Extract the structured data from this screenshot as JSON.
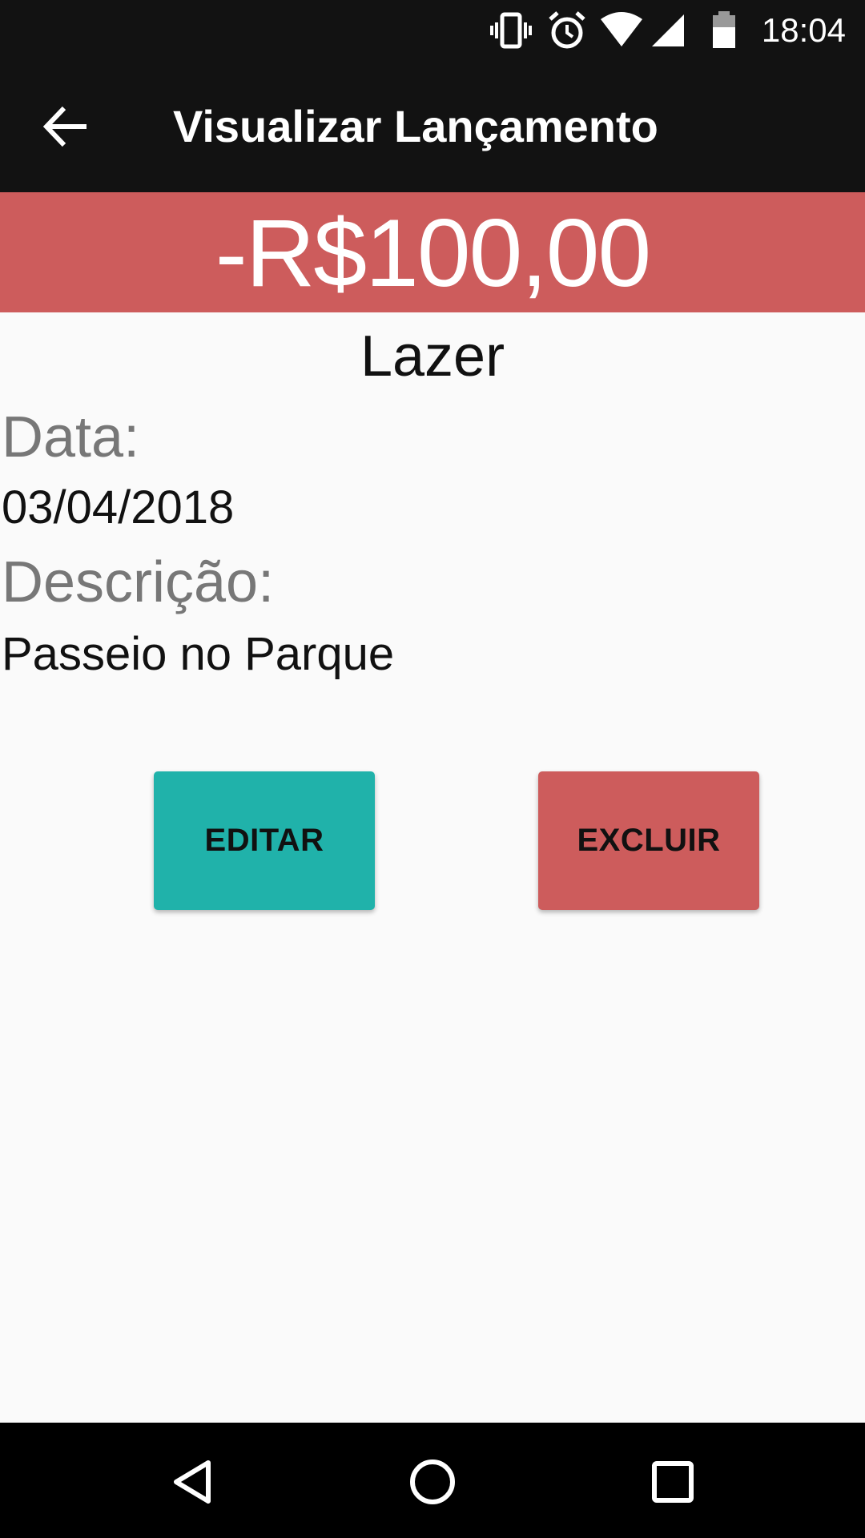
{
  "status_bar": {
    "time": "18:04",
    "icons": [
      "vibrate-icon",
      "alarm-icon",
      "wifi-icon",
      "cellular-signal-icon",
      "battery-icon"
    ]
  },
  "toolbar": {
    "back_icon": "arrow-back-icon",
    "title": "Visualizar Lançamento",
    "background": "#121212"
  },
  "transaction": {
    "amount": "-R$100,00",
    "amount_color": "#cd5c5c",
    "category": "Lazer",
    "date_label": "Data:",
    "date_value": "03/04/2018",
    "description_label": "Descrição:",
    "description_value": "Passeio no Parque"
  },
  "actions": {
    "edit_label": "EDITAR",
    "edit_color": "#20b2aa",
    "delete_label": "EXCLUIR",
    "delete_color": "#cd5c5c"
  },
  "nav_bar": {
    "icons": [
      "nav-back-icon",
      "nav-home-icon",
      "nav-recents-icon"
    ]
  }
}
